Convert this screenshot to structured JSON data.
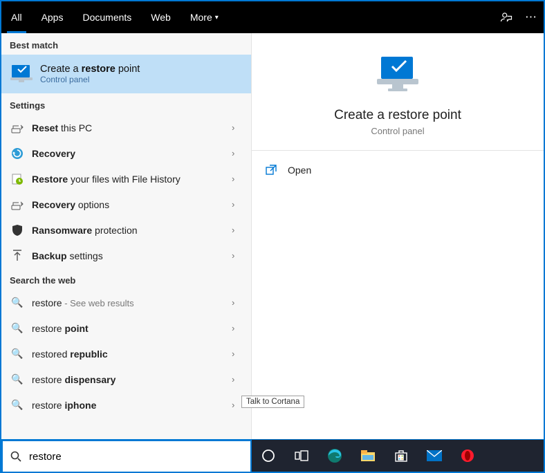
{
  "tabs": {
    "all": "All",
    "apps": "Apps",
    "documents": "Documents",
    "web": "Web",
    "more": "More"
  },
  "best_match": {
    "heading": "Best match",
    "title_pre": "Create a ",
    "title_bold": "restore",
    "title_post": " point",
    "subtitle": "Control panel"
  },
  "settings": {
    "heading": "Settings",
    "items": [
      {
        "label_pre": "",
        "label_bold": "Reset",
        "label_post": " this PC"
      },
      {
        "label_pre": "",
        "label_bold": "Recovery",
        "label_post": ""
      },
      {
        "label_pre": "",
        "label_bold": "Restore",
        "label_post": " your files with File History"
      },
      {
        "label_pre": "",
        "label_bold": "Recovery",
        "label_post": " options"
      },
      {
        "label_pre": "",
        "label_bold": "Ransomware",
        "label_post": " protection"
      },
      {
        "label_pre": "",
        "label_bold": "Backup",
        "label_post": " settings"
      }
    ]
  },
  "web": {
    "heading": "Search the web",
    "hint": " - See web results",
    "items": [
      {
        "label_pre": "restore",
        "label_bold": "",
        "label_post": ""
      },
      {
        "label_pre": "restore ",
        "label_bold": "point",
        "label_post": ""
      },
      {
        "label_pre": "restored ",
        "label_bold": "republic",
        "label_post": ""
      },
      {
        "label_pre": "restore ",
        "label_bold": "dispensary",
        "label_post": ""
      },
      {
        "label_pre": "restore ",
        "label_bold": "iphone",
        "label_post": ""
      }
    ]
  },
  "preview": {
    "title": "Create a restore point",
    "subtitle": "Control panel",
    "open": "Open"
  },
  "tooltip": "Talk to Cortana",
  "search": {
    "value": "restore"
  }
}
